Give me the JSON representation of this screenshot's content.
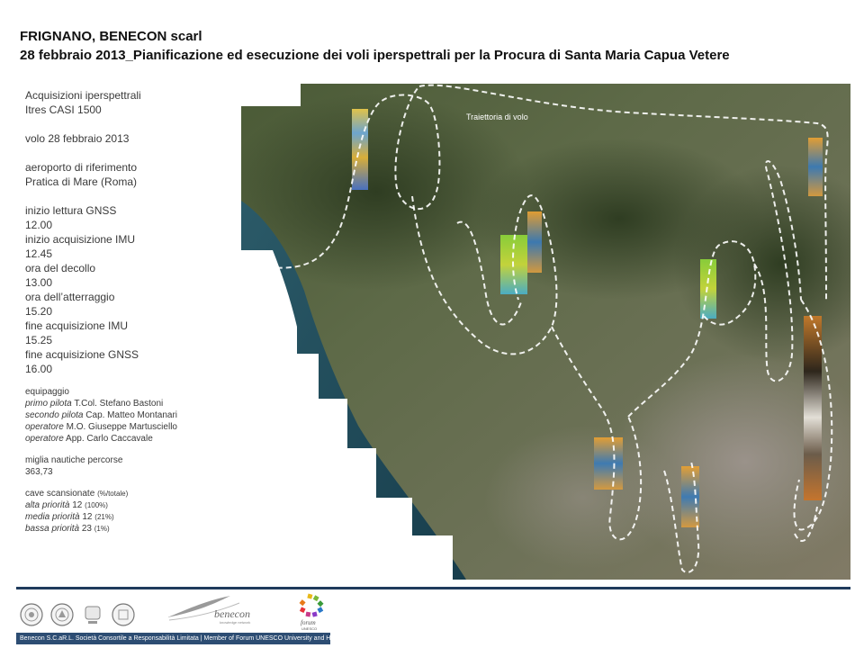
{
  "header": {
    "line1": "FRIGNANO, BENECON scarl",
    "line2": "28 febbraio 2013_Pianificazione ed esecuzione dei voli iperspettrali per la Procura di Santa Maria Capua Vetere"
  },
  "info": {
    "acq_title": "Acquisizioni iperspettrali",
    "sensor": "Itres CASI 1500",
    "flight": "volo  28 febbraio  2013",
    "airport_label": "aeroporto  di riferimento",
    "airport": "Pratica di Mare (Roma)",
    "gnss_start_label": "inizio lettura GNSS",
    "gnss_start": "12.00",
    "imu_start_label": "inizio acquisizione IMU",
    "imu_start": "12.45",
    "takeoff_label": "ora del decollo",
    "takeoff": "13.00",
    "landing_label": "ora dell’atterraggio",
    "landing": "15.20",
    "imu_end_label": "fine  acquisizione IMU",
    "imu_end": "15.25",
    "gnss_end_label": "fine  acquisizione GNSS",
    "gnss_end": "16.00",
    "crew_label": "equipaggio",
    "crew": [
      {
        "role": "primo pilota",
        "name": "T.Col.  Stefano Bastoni"
      },
      {
        "role": "secondo pilota",
        "name": "Cap.  Matteo Montanari"
      },
      {
        "role": "operatore",
        "name": "M.O.  Giuseppe Martusciello"
      },
      {
        "role": "operatore",
        "name": "App.  Carlo Caccavale"
      }
    ],
    "miles_label": "miglia  nautiche percorse",
    "miles": "363,73",
    "quarries_label": "cave scansionate",
    "quarries_unit": "(%/totale)",
    "priorities": [
      {
        "label": "alta priorità",
        "count": "12",
        "pct": "(100%)"
      },
      {
        "label": "media priorità",
        "count": "12",
        "pct": "(21%)"
      },
      {
        "label": "bassa priorità",
        "count": "23",
        "pct": "(1%)"
      }
    ]
  },
  "map": {
    "trajectory_label": "Traiettoria di volo"
  },
  "logos": {
    "benecon_name": "benecon",
    "benecon_tag": "knowledge network",
    "forum_name": "forum",
    "forum_sub": "UNESCO"
  },
  "footer": {
    "text": "Benecon S.C.aR.L. Società Consortile a Responsabilità Limitata | Member of Forum UNESCO University and Heritage"
  }
}
